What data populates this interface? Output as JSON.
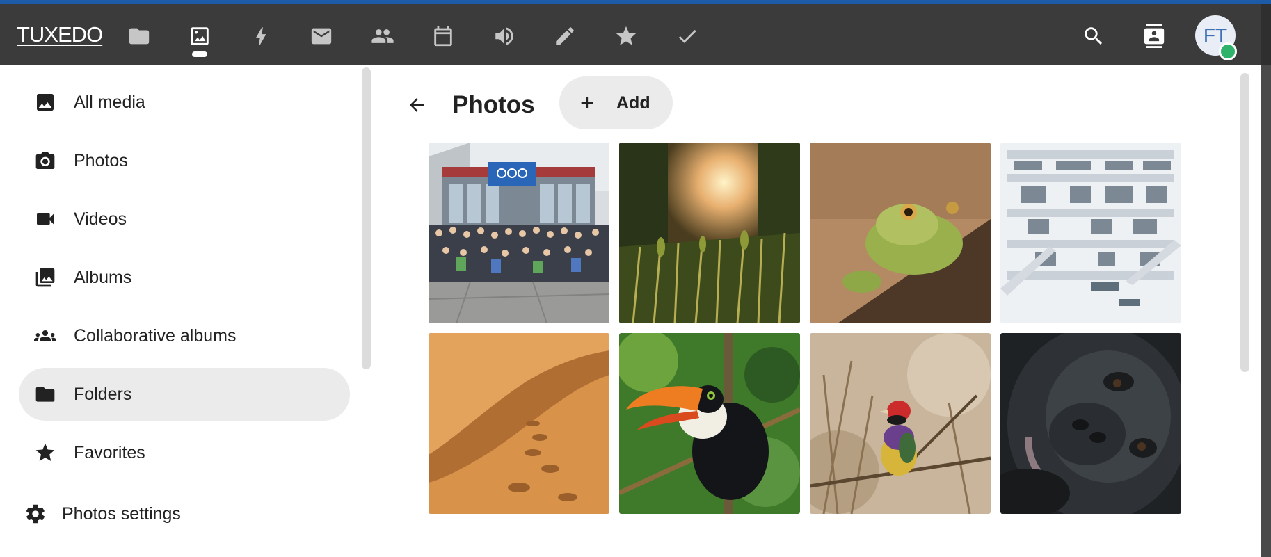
{
  "header": {
    "logo_text": "TUXEDO",
    "apps": [
      {
        "name": "files-icon"
      },
      {
        "name": "photos-icon",
        "active": true
      },
      {
        "name": "activity-icon"
      },
      {
        "name": "mail-icon"
      },
      {
        "name": "contacts-icon"
      },
      {
        "name": "calendar-icon"
      },
      {
        "name": "announcements-icon"
      },
      {
        "name": "notes-icon"
      },
      {
        "name": "favorites-icon"
      },
      {
        "name": "tasks-icon"
      }
    ],
    "avatar_initials": "FT",
    "status_color": "#2fb36a"
  },
  "sidebar": {
    "items": [
      {
        "label": "All media",
        "icon": "image-icon"
      },
      {
        "label": "Photos",
        "icon": "camera-icon"
      },
      {
        "label": "Videos",
        "icon": "video-icon"
      },
      {
        "label": "Albums",
        "icon": "albums-icon"
      },
      {
        "label": "Collaborative albums",
        "icon": "group-icon"
      },
      {
        "label": "Folders",
        "icon": "folder-icon",
        "active": true
      },
      {
        "label": "Favorites",
        "icon": "star-icon"
      }
    ],
    "settings_label": "Photos settings"
  },
  "main": {
    "title": "Photos",
    "add_label": "Add",
    "photos": [
      {
        "name": "photo-group-conference"
      },
      {
        "name": "photo-grass-field"
      },
      {
        "name": "photo-frog"
      },
      {
        "name": "photo-library"
      },
      {
        "name": "photo-desert-dunes"
      },
      {
        "name": "photo-toucan"
      },
      {
        "name": "photo-finch"
      },
      {
        "name": "photo-gorilla"
      }
    ]
  },
  "colors": {
    "header_bg": "#3b3b3b",
    "accent_strip": "#1d5aa8",
    "active_bg": "#ebebeb"
  }
}
